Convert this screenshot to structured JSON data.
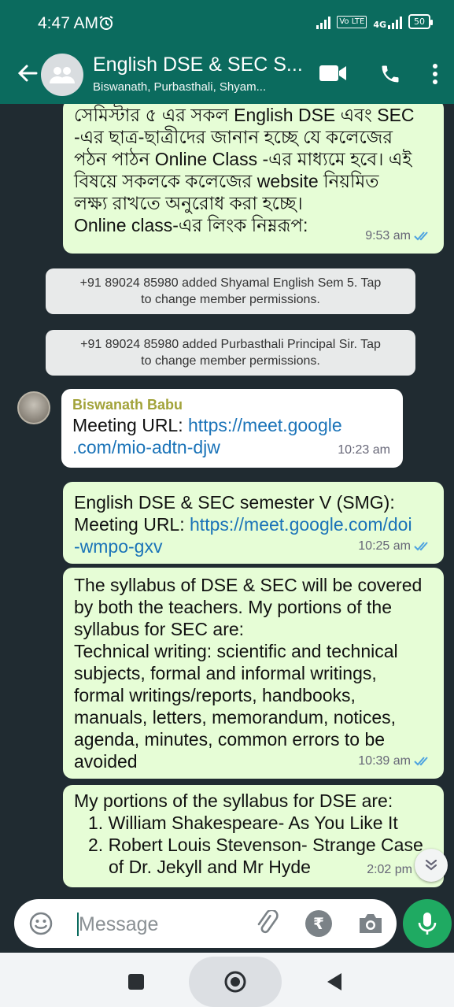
{
  "status_bar": {
    "time": "4:47 AM",
    "network": "4G",
    "volte": "Vo LTE",
    "battery": "50"
  },
  "header": {
    "title": "English DSE & SEC S...",
    "subtitle": "Biswanath, Purbasthali, Shyam..."
  },
  "messages": [
    {
      "type": "outgoing",
      "lines": [
        "সেমিস্টার ৫ এর সকল English DSE এবং SEC",
        "-এর ছাত্র-ছাত্রীদের জানান হচ্ছে যে কলেজের",
        "পঠন পাঠন Online Class -এর মাধ্যমে হবে। এই",
        "বিষয়ে সকলকে  কলেজের website নিয়মিত",
        "লক্ষ্য রাখতে অনুরোধ করা হচ্ছে।",
        "Online class-এর লিংক নিম্নরূপ:"
      ],
      "time": "9:53 am"
    },
    {
      "type": "system",
      "line1": "+91 89024 85980 added Shyamal English Sem 5. Tap",
      "line2": "to change member permissions."
    },
    {
      "type": "system",
      "line1": "+91 89024 85980 added Purbasthali Principal Sir. Tap",
      "line2": "to change member permissions."
    },
    {
      "type": "incoming",
      "sender": "Biswanath Babu",
      "label": "Meeting URL: ",
      "link1": "https://meet.google",
      "link2": ".com/mio-adtn-djw",
      "time": "10:23 am"
    },
    {
      "type": "outgoing",
      "line1": "English DSE & SEC semester V (SMG):",
      "label": "Meeting URL: ",
      "link1": "https://meet.google.com/doi",
      "link2": "-wmpo-gxv",
      "time": "10:25 am"
    },
    {
      "type": "outgoing",
      "lines": [
        "The syllabus of DSE & SEC will be covered",
        "by both the teachers. My portions of the",
        "syllabus for SEC are:",
        "Technical writing: scientific and technical",
        "subjects, formal and informal writings,",
        "formal writings/reports, handbooks,",
        "manuals, letters, memorandum, notices,",
        "agenda, minutes, common errors to be",
        "avoided"
      ],
      "time": "10:39 am"
    },
    {
      "type": "outgoing",
      "intro": "My portions of the syllabus for DSE are:",
      "item1": "1. William Shakespeare- As You Like It",
      "item2a": "2. Robert Louis Stevenson- Strange Case",
      "item2b": "of Dr. Jekyll and Mr Hyde",
      "time": "2:02 pm"
    }
  ],
  "input": {
    "placeholder": "Message"
  },
  "colors": {
    "header": "#0b6b5e",
    "outgoing_bubble": "#e6fdd6",
    "mic_button": "#1faa62",
    "link": "#1a73b8"
  }
}
